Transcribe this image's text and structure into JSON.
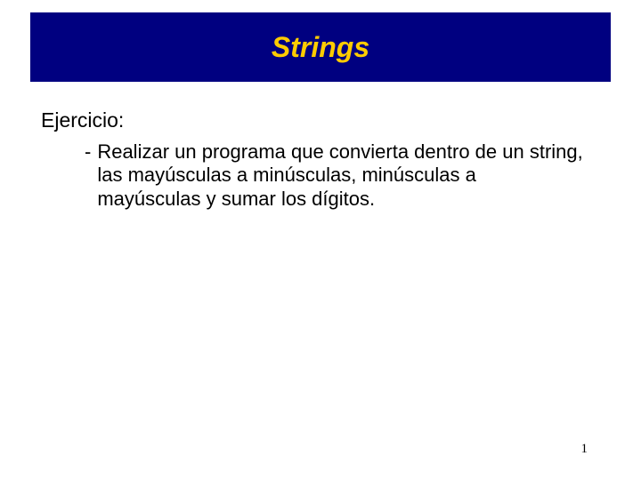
{
  "title": "Strings",
  "section_heading": "Ejercicio:",
  "bullet": {
    "marker": "-",
    "text": "Realizar un programa que convierta dentro de un string, las mayúsculas a minúsculas, minúsculas a mayúsculas y sumar los dígitos."
  },
  "page_number": "1"
}
